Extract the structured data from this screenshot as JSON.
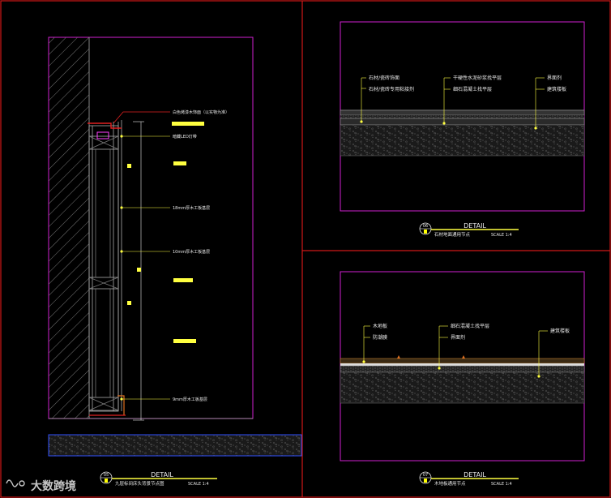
{
  "colors": {
    "background": "#000000",
    "frame": "#d01818",
    "viewport": "#d020d0",
    "leader": "#ffff40",
    "label": "#e8e8e8",
    "highlight": "#ffff40",
    "title": "#e8e8e8",
    "marker": "#ffff00"
  },
  "panel_left": {
    "labels": [
      "白色烤漆木饰面（以实物为准）",
      "暗藏LED灯带",
      "18mm厚木工板基层",
      "10mm厚木工板基层",
      "9mm厚木工板基层"
    ],
    "title_block": {
      "number": "05",
      "heading": "DETAIL",
      "name": "九层标间床头背景节点图",
      "scale": "SCALE 1:4"
    }
  },
  "panel_top_right": {
    "labels_left": [
      "石材/瓷砖饰面",
      "石材/瓷砖专用粘接剂"
    ],
    "labels_mid": [
      "干硬性水泥砂浆找平层",
      "细石混凝土找平层"
    ],
    "labels_right": [
      "界面剂",
      "建筑楼板"
    ],
    "title_block": {
      "number": "06",
      "heading": "DETAIL",
      "name": "石材地面通用节点",
      "scale": "SCALE 1:4"
    }
  },
  "panel_bottom_right": {
    "labels_left": [
      "木地板",
      "防潮膜"
    ],
    "labels_mid": [
      "细石混凝土找平层",
      "界面剂"
    ],
    "labels_right": [
      "建筑楼板"
    ],
    "title_block": {
      "number": "07",
      "heading": "DETAIL",
      "name": "木地板通用节点",
      "scale": "SCALE 1:4"
    }
  },
  "watermark": {
    "text": "大数跨境"
  }
}
